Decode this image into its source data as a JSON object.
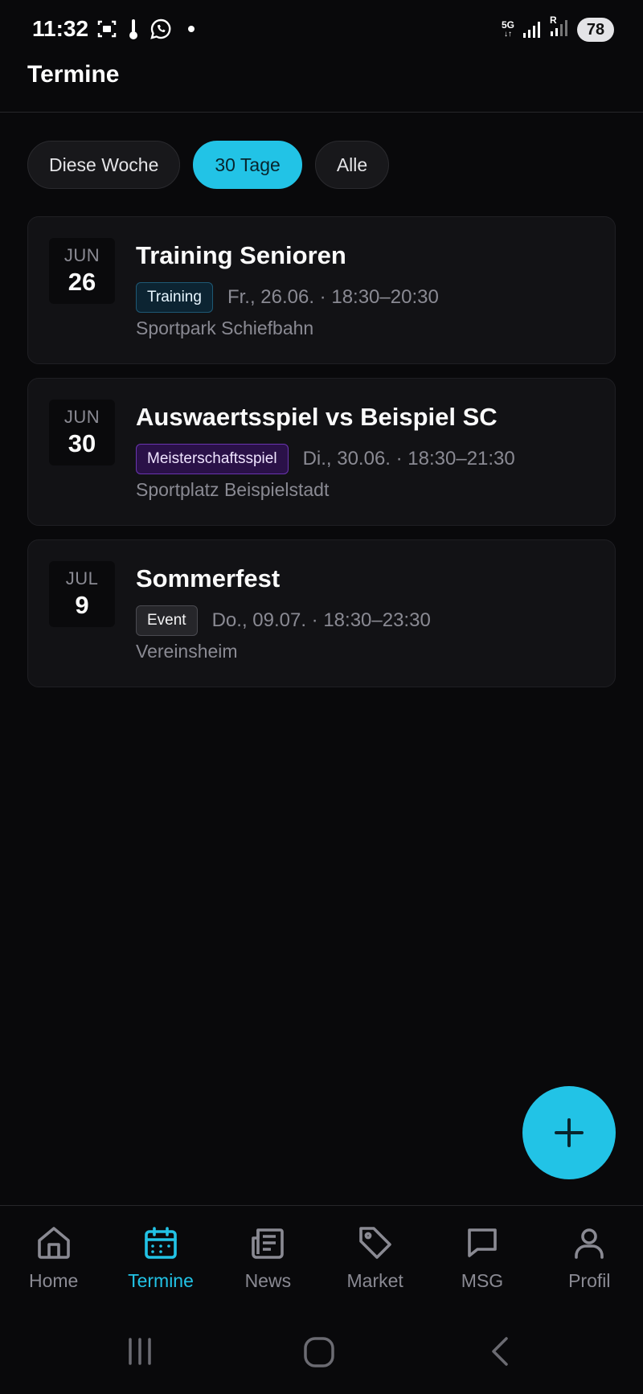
{
  "status_bar": {
    "time": "11:32",
    "network": "5G",
    "roaming": "R",
    "battery": "78"
  },
  "header": {
    "title": "Termine"
  },
  "filters": [
    {
      "label": "Diese Woche",
      "active": false
    },
    {
      "label": "30 Tage",
      "active": true
    },
    {
      "label": "Alle",
      "active": false
    }
  ],
  "events": [
    {
      "month": "JUN",
      "day": "26",
      "title": "Training Senioren",
      "tag": "Training",
      "when": "Fr., 26.06. · 18:30–20:30",
      "location": "Sportpark Schiefbahn"
    },
    {
      "month": "JUN",
      "day": "30",
      "title": "Auswaertsspiel vs Beispiel SC",
      "tag": "Meisterschaftsspiel",
      "when": "Di., 30.06. · 18:30–21:30",
      "location": "Sportplatz Beispielstadt"
    },
    {
      "month": "JUL",
      "day": "9",
      "title": "Sommerfest",
      "tag": "Event",
      "when": "Do., 09.07. · 18:30–23:30",
      "location": "Vereinsheim"
    }
  ],
  "fab": {
    "icon": "plus-icon"
  },
  "bottom_nav": [
    {
      "label": "Home",
      "icon": "home-icon",
      "active": false
    },
    {
      "label": "Termine",
      "icon": "calendar-icon",
      "active": true
    },
    {
      "label": "News",
      "icon": "newspaper-icon",
      "active": false
    },
    {
      "label": "Market",
      "icon": "tag-icon",
      "active": false
    },
    {
      "label": "MSG",
      "icon": "chat-icon",
      "active": false
    },
    {
      "label": "Profil",
      "icon": "user-icon",
      "active": false
    }
  ],
  "colors": {
    "background": "#09090b",
    "card": "#121215",
    "accent": "#22c3e6",
    "muted_text": "#8a8a93",
    "tag_training": "#0c2432",
    "tag_match": "#2a1148",
    "tag_event": "#26262a"
  }
}
